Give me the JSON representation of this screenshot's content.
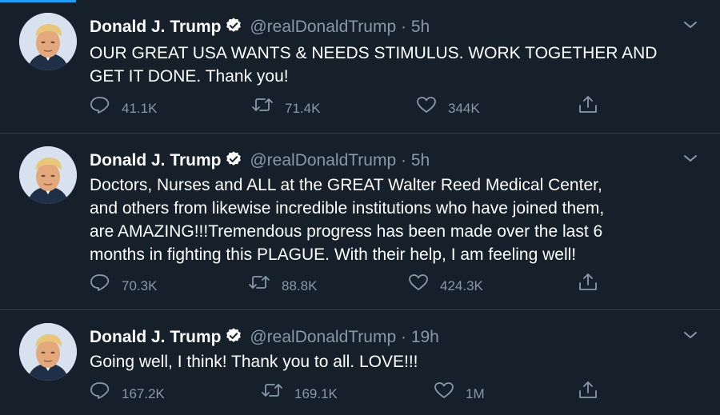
{
  "author": {
    "name": "Donald J. Trump",
    "handle": "@realDonaldTrump",
    "separator": "·"
  },
  "colors": {
    "background": "#15202b",
    "divider": "#38444d",
    "muted": "#8899a6",
    "accent": "#1da1f2"
  },
  "icons": {
    "reply": "reply-icon",
    "retweet": "retweet-icon",
    "like": "like-icon",
    "share": "share-icon",
    "verified": "verified-badge-icon",
    "menu": "chevron-down-icon"
  },
  "tweets": [
    {
      "time": "5h",
      "lines": [
        "OUR GREAT USA WANTS & NEEDS STIMULUS. WORK TOGETHER AND",
        "GET IT DONE. Thank you!"
      ],
      "replies": "41.1K",
      "retweets": "71.4K",
      "likes": "344K"
    },
    {
      "time": "5h",
      "lines": [
        "Doctors, Nurses and ALL at the GREAT Walter Reed Medical Center,",
        "and others from likewise incredible institutions who have joined them,",
        "are AMAZING!!!Tremendous progress has been made over the last 6",
        "months in fighting this PLAGUE. With their help, I am feeling well!"
      ],
      "replies": "70.3K",
      "retweets": "88.8K",
      "likes": "424.3K"
    },
    {
      "time": "19h",
      "lines": [
        "Going well, I think! Thank you to all. LOVE!!!"
      ],
      "replies": "167.2K",
      "retweets": "169.1K",
      "likes": "1M"
    }
  ]
}
